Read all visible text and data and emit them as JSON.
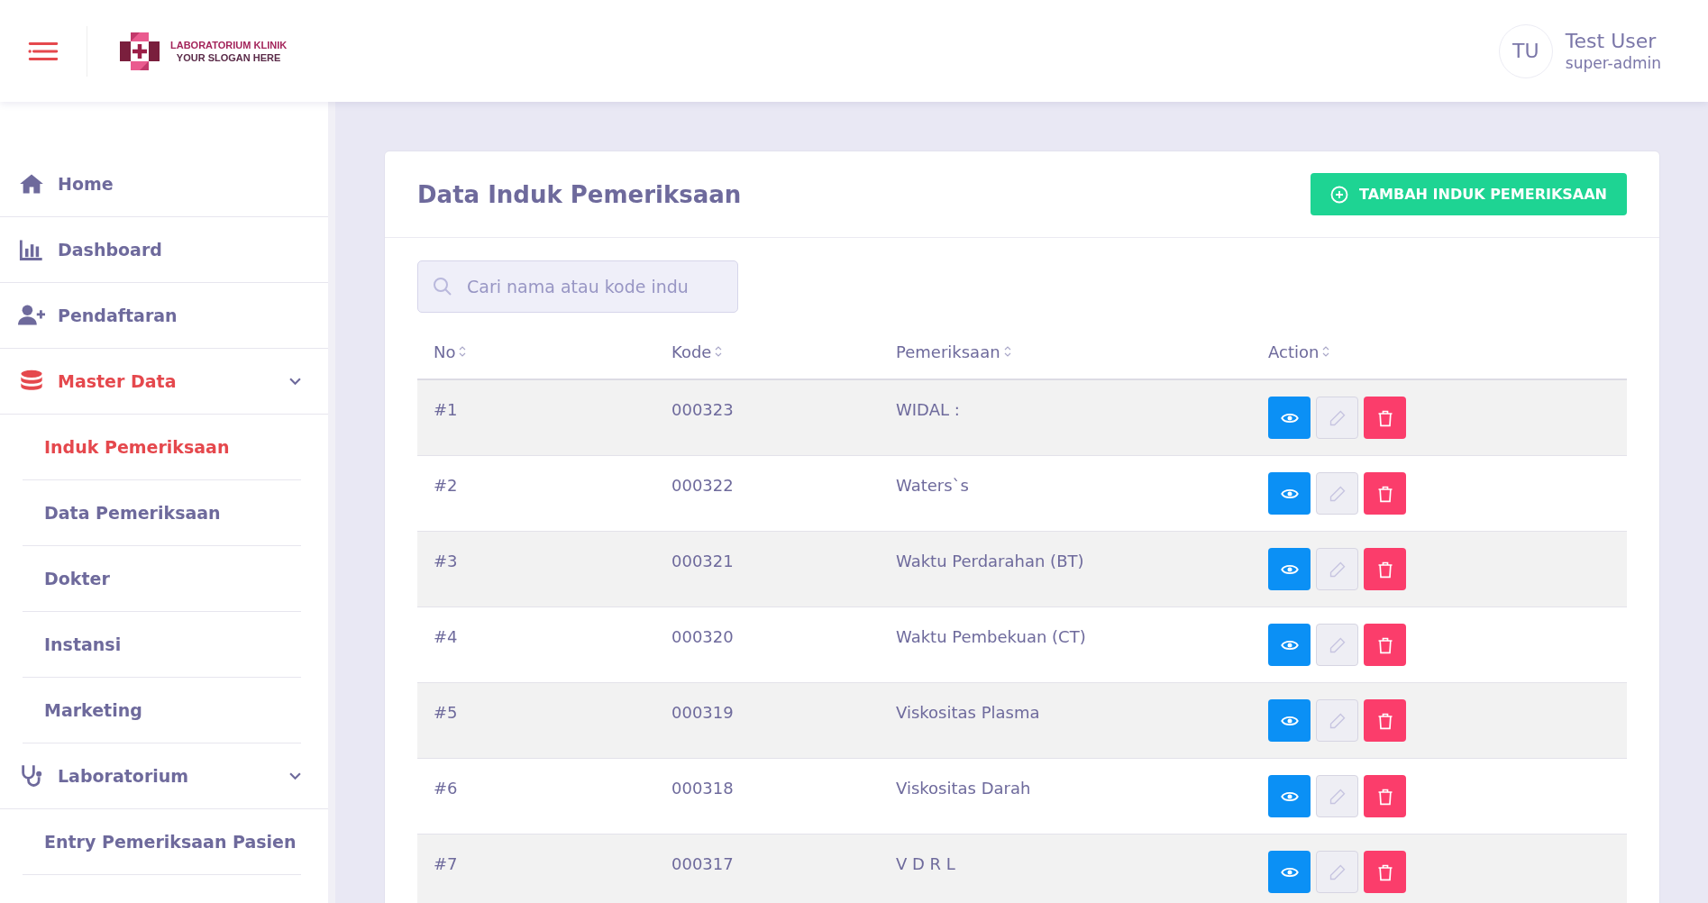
{
  "header": {
    "brand": {
      "title": "LABORATORIUM KLINIK",
      "slogan": "YOUR SLOGAN HERE"
    },
    "user": {
      "initials": "TU",
      "name": "Test User",
      "role": "super-admin"
    }
  },
  "sidebar": {
    "items": [
      {
        "label": "Home",
        "selected": false
      },
      {
        "label": "Dashboard",
        "selected": false
      },
      {
        "label": "Pendaftaran",
        "selected": false
      },
      {
        "label": "Master Data",
        "selected": true,
        "expanded": true,
        "children": [
          {
            "label": "Induk Pemeriksaan",
            "selected": true
          },
          {
            "label": "Data Pemeriksaan",
            "selected": false
          },
          {
            "label": "Dokter",
            "selected": false
          },
          {
            "label": "Instansi",
            "selected": false
          },
          {
            "label": "Marketing",
            "selected": false
          }
        ]
      },
      {
        "label": "Laboratorium",
        "selected": false,
        "expanded": true,
        "children": [
          {
            "label": "Entry Pemeriksaan Pasien",
            "selected": false
          }
        ]
      }
    ]
  },
  "card": {
    "title": "Data Induk Pemeriksaan",
    "add_button": "TAMBAH INDUK PEMERIKSAAN",
    "search": {
      "placeholder": "Cari nama atau kode indu"
    },
    "table": {
      "columns": [
        "No",
        "Kode",
        "Pemeriksaan",
        "Action"
      ],
      "rows": [
        {
          "no": "#1",
          "kode": "000323",
          "pemeriksaan": "WIDAL :"
        },
        {
          "no": "#2",
          "kode": "000322",
          "pemeriksaan": "Waters`s"
        },
        {
          "no": "#3",
          "kode": "000321",
          "pemeriksaan": "Waktu Perdarahan (BT)"
        },
        {
          "no": "#4",
          "kode": "000320",
          "pemeriksaan": "Waktu Pembekuan (CT)"
        },
        {
          "no": "#5",
          "kode": "000319",
          "pemeriksaan": "Viskositas Plasma"
        },
        {
          "no": "#6",
          "kode": "000318",
          "pemeriksaan": "Viskositas Darah"
        },
        {
          "no": "#7",
          "kode": "000317",
          "pemeriksaan": "V D R L"
        }
      ]
    }
  }
}
